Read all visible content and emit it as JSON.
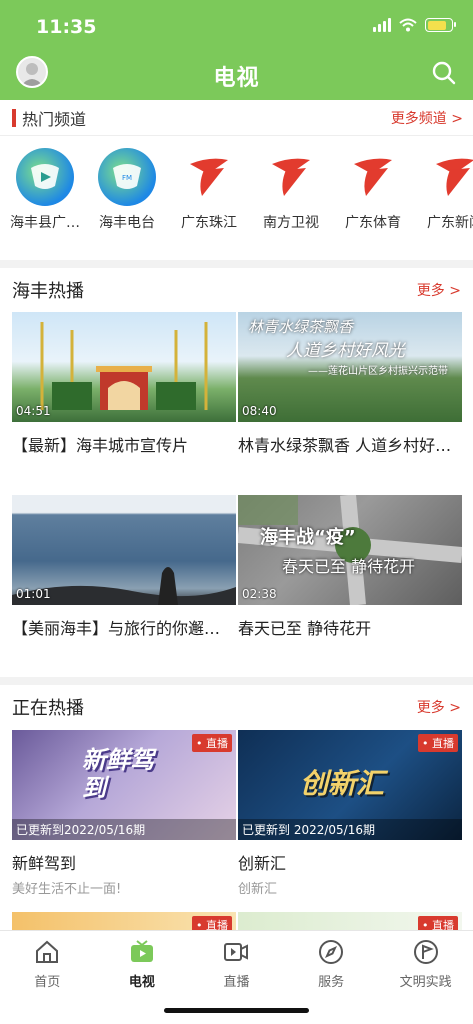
{
  "status": {
    "time": "11:35"
  },
  "header": {
    "title": "电视"
  },
  "hot_channels": {
    "title": "热门频道",
    "more": "更多频道 >",
    "items": [
      {
        "name": "海丰县广…"
      },
      {
        "name": "海丰电台"
      },
      {
        "name": "广东珠江"
      },
      {
        "name": "南方卫视"
      },
      {
        "name": "广东体育"
      },
      {
        "name": "广东新闻"
      }
    ]
  },
  "haifeng_hot": {
    "title": "海丰热播",
    "more": "更多 >",
    "items": [
      {
        "title": "【最新】海丰城市宣传片",
        "duration": "04:51"
      },
      {
        "title": "林青水绿茶飘香 人道乡村好…",
        "duration": "08:40",
        "overlay1": "林青水绿茶飘香",
        "overlay2": "人道乡村好风光",
        "overlay3": "——莲花山片区乡村振兴示范带"
      },
      {
        "title": "【美丽海丰】与旅行的你邂…",
        "duration": "01:01"
      },
      {
        "title": "春天已至 静待花开",
        "duration": "02:38",
        "overlay1": "海丰战“疫”",
        "overlay2": "春天已至 静待花开"
      }
    ]
  },
  "now_playing": {
    "title": "正在热播",
    "more": "更多 >",
    "items": [
      {
        "title": "新鲜驾到",
        "subtitle": "美好生活不止一面!",
        "badge": "• 直播",
        "updated": "已更新到2022/05/16期",
        "art": "新鲜驾到"
      },
      {
        "title": "创新汇",
        "subtitle": "创新汇",
        "badge": "• 直播",
        "updated": "已更新到 2022/05/16期",
        "art": "创新汇"
      }
    ],
    "partial_badges": [
      "• 直播",
      "• 直播"
    ]
  },
  "tabbar": {
    "items": [
      {
        "label": "首页",
        "icon": "home-icon"
      },
      {
        "label": "电视",
        "icon": "tv-icon"
      },
      {
        "label": "直播",
        "icon": "live-icon"
      },
      {
        "label": "服务",
        "icon": "compass-icon"
      },
      {
        "label": "文明实践",
        "icon": "flag-icon"
      }
    ]
  },
  "colors": {
    "brand_green": "#7cc95a",
    "accent_red": "#d83a2e"
  }
}
